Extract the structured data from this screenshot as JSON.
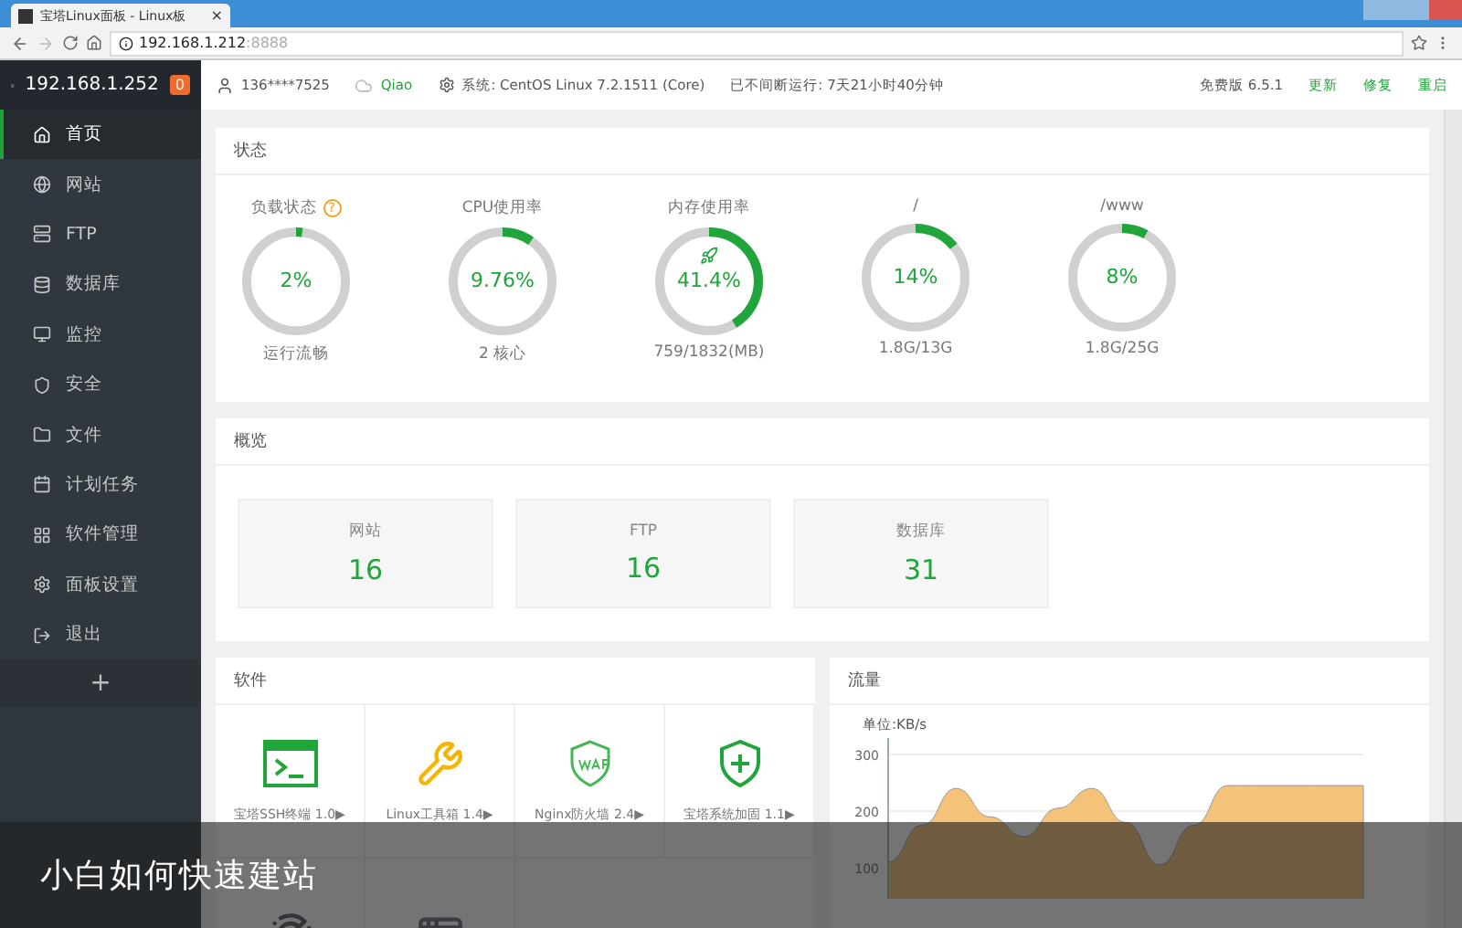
{
  "browser": {
    "tab_title": "宝塔Linux面板 - Linux板",
    "tab_close": "×",
    "address": "192.168.1.212",
    "address_port": ":8888"
  },
  "sidebar": {
    "host": "192.168.1.252",
    "badge": "0",
    "items": [
      {
        "label": "首页",
        "selected": true
      },
      {
        "label": "网站",
        "selected": false
      },
      {
        "label": "FTP",
        "selected": false
      },
      {
        "label": "数据库",
        "selected": false
      },
      {
        "label": "监控",
        "selected": false
      },
      {
        "label": "安全",
        "selected": false
      },
      {
        "label": "文件",
        "selected": false
      },
      {
        "label": "计划任务",
        "selected": false
      },
      {
        "label": "软件管理",
        "selected": false
      },
      {
        "label": "面板设置",
        "selected": false
      },
      {
        "label": "退出",
        "selected": false
      }
    ],
    "add": "+"
  },
  "header": {
    "user": "136****7525",
    "cloud_user": "Qiao",
    "system": "系统:  CentOS Linux 7.2.1511 (Core)",
    "uptime": "已不间断运行: 7天21小时40分钟",
    "version": "免费版 6.5.1",
    "actions": [
      "更新",
      "修复",
      "重启"
    ]
  },
  "status": {
    "title": "状态",
    "gauges": [
      {
        "label": "负载状态",
        "help": "?",
        "value": "2%",
        "level": 0.02,
        "caption": "运行流畅"
      },
      {
        "label": "CPU使用率",
        "value": "9.76%",
        "level": 0.0976,
        "caption": "2 核心"
      },
      {
        "label": "内存使用率",
        "value": "41.4%",
        "level": 0.414,
        "caption": "759/1832(MB)",
        "rocket": true
      },
      {
        "label": "/",
        "value": "14%",
        "level": 0.14,
        "caption": "1.8G/13G"
      },
      {
        "label": "/www",
        "value": "8%",
        "level": 0.08,
        "caption": "1.8G/25G"
      }
    ]
  },
  "overview": {
    "title": "概览",
    "stats": [
      {
        "label": "网站",
        "value": "16"
      },
      {
        "label": "FTP",
        "value": "16"
      },
      {
        "label": "数据库",
        "value": "31"
      }
    ]
  },
  "software": {
    "title": "软件",
    "items": [
      {
        "kind": "terminal",
        "label": "宝塔SSH终端 1.0▶"
      },
      {
        "kind": "tools",
        "label": "Linux工具箱 1.4▶"
      },
      {
        "kind": "waf",
        "label": "Nginx防火墙 2.4▶"
      },
      {
        "kind": "shield",
        "label": "宝塔系统加固 1.1▶"
      },
      {
        "kind": "radar"
      },
      {
        "kind": "window"
      }
    ]
  },
  "traffic": {
    "title": "流量",
    "unit": "单位:KB/s",
    "chart_data": {
      "type": "area",
      "yticks": [
        100,
        200,
        300
      ],
      "ylim": [
        0,
        300
      ],
      "series": [
        {
          "color": "#f5c27a",
          "values": [
            110,
            175,
            240,
            190,
            155,
            205,
            240,
            180,
            105,
            175,
            245,
            245,
            245,
            245,
            245
          ]
        }
      ]
    }
  },
  "caption": "小白如何快速建站"
}
